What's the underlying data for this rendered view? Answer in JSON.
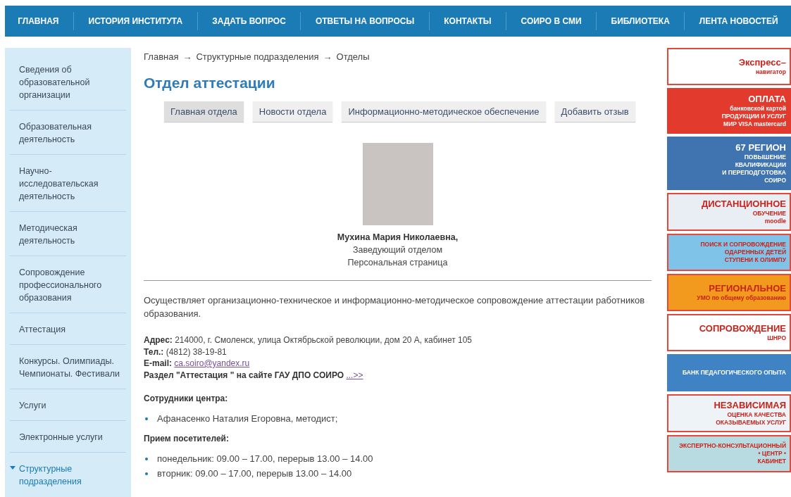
{
  "nav": [
    "ГЛАВНАЯ",
    "ИСТОРИЯ ИНСТИТУТА",
    "ЗАДАТЬ ВОПРОС",
    "ОТВЕТЫ НА ВОПРОСЫ",
    "КОНТАКТЫ",
    "СОИРО В СМИ",
    "БИБЛИОТЕКА",
    "ЛЕНТА НОВОСТЕЙ"
  ],
  "sidebar": {
    "items": [
      {
        "label": "Сведения об образовательной организации",
        "selected": false,
        "expanded": false
      },
      {
        "label": "Образовательная деятельность",
        "selected": false,
        "expanded": false
      },
      {
        "label": "Научно-исследовательская деятельность",
        "selected": false,
        "expanded": false
      },
      {
        "label": "Методическая деятельность",
        "selected": false,
        "expanded": false
      },
      {
        "label": "Сопровождение профессионального образования",
        "selected": false,
        "expanded": false
      },
      {
        "label": "Аттестация",
        "selected": false,
        "expanded": false
      },
      {
        "label": "Конкурсы. Олимпиады. Чемпионаты. Фестивали",
        "selected": false,
        "expanded": false
      },
      {
        "label": "Услуги",
        "selected": false,
        "expanded": false
      },
      {
        "label": "Электронные услуги",
        "selected": false,
        "expanded": false
      },
      {
        "label": "Структурные подразделения",
        "selected": true,
        "expanded": true
      }
    ]
  },
  "breadcrumbs": [
    "Главная",
    "Структурные подразделения",
    "Отделы"
  ],
  "breadcrumb_separator": "→",
  "title": "Отдел аттестации",
  "tabs": [
    {
      "label": "Главная отдела",
      "selected": true
    },
    {
      "label": "Новости отдела",
      "selected": false
    },
    {
      "label": "Информационно-методическое обеспечение",
      "selected": false
    },
    {
      "label": "Добавить отзыв",
      "selected": false
    }
  ],
  "head": {
    "name": "Мухина Мария Николаевна,",
    "position": "Заведующий отделом",
    "page_link": "Персональная страница"
  },
  "description": "Осуществляет организационно-техническое и информационно-методическое сопровождение аттестации работников образования.",
  "contacts": [
    {
      "kind": "text",
      "label": "Адрес:",
      "value": "214000, г. Смоленск, улица Октябрьской революции, дом 20 А, кабинет 105"
    },
    {
      "kind": "text",
      "label": "Тел.:",
      "value": "(4812) 38-19-81"
    },
    {
      "kind": "link",
      "label": "E-mail:",
      "value": "ca.soiro@yandex.ru"
    },
    {
      "kind": "bold_link",
      "label": "Раздел \"Аттестация \" на сайте ГАУ ДПО СОИРО",
      "value": "...>>"
    }
  ],
  "staff": {
    "heading": "Сотрудники центра:",
    "items": [
      "Афанасенко Наталия Егоровна, методист;"
    ]
  },
  "visitors": {
    "heading": "Прием посетителей:",
    "items": [
      "понедельник: 09.00 – 17.00, перерыв 13.00 – 14.00",
      "вторник: 09.00 – 17.00, перерыв 13.00 – 14.00"
    ]
  },
  "banners": [
    {
      "color": "#ffffff",
      "lines": [
        "Экспресс–",
        "навигатор"
      ]
    },
    {
      "color": "#e23a2c",
      "lines": [
        "ОПЛАТА",
        "банковской картой",
        "ПРОДУКЦИИ И УСЛУГ",
        "МИР VISA mastercard"
      ]
    },
    {
      "color": "#3f74b0",
      "lines": [
        "67 РЕГИОН",
        "ПОВЫШЕНИЕ",
        "КВАЛИФИКАЦИИ",
        "И ПЕРЕПОДГОТОВКА",
        "СОИРО"
      ]
    },
    {
      "color": "#e8eef4",
      "lines": [
        "ДИСТАНЦИОННОЕ",
        "ОБУЧЕНИЕ",
        "moodle"
      ]
    },
    {
      "color": "#7fc3e8",
      "lines": [
        "ПОИСК И СОПРОВОЖДЕНИЕ ОДАРЕННЫХ ДЕТЕЙ",
        "СТУПЕНИ К ОЛИМПУ"
      ]
    },
    {
      "color": "#f19a1e",
      "lines": [
        "РЕГИОНАЛЬНОЕ",
        "УМО по общему образованию"
      ]
    },
    {
      "color": "#ffffff",
      "lines": [
        "СОПРОВОЖДЕНИЕ",
        "ШНРО"
      ]
    },
    {
      "color": "#3f83c4",
      "lines": [
        "БАНК ПЕДАГОГИЧЕСКОГО ОПЫТА"
      ]
    },
    {
      "color": "#eef3f8",
      "lines": [
        "НЕЗАВИСИМАЯ",
        "ОЦЕНКА КАЧЕСТВА",
        "ОКАЗЫВАЕМЫХ УСЛУГ"
      ]
    },
    {
      "color": "#b7dbe0",
      "lines": [
        "ЭКСПЕРТНО-КОНСУЛЬТАЦИОННЫЙ",
        "• ЦЕНТР •",
        "КАБИНЕТ"
      ]
    }
  ]
}
